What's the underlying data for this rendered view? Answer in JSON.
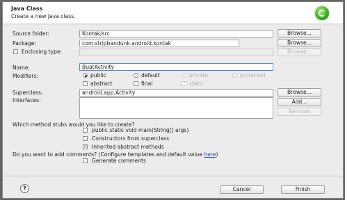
{
  "dialog": {
    "title": "Java Class",
    "message": "Create a new Java class."
  },
  "form": {
    "source_folder": {
      "label": "Source folder:",
      "value": "Kontak/src",
      "browse": "Browse..."
    },
    "package": {
      "label": "Package:",
      "value": "com.stripbandunk.android.kontak",
      "browse": "Browse..."
    },
    "enclosing_type": {
      "label": "Enclosing type:",
      "value": "",
      "browse": "Browse..."
    },
    "name": {
      "label": "Name:",
      "value": "BuatActivity"
    },
    "modifiers": {
      "label": "Modifiers:",
      "public": "public",
      "default": "default",
      "private": "private",
      "protected": "protected",
      "abstract": "abstract",
      "final": "final",
      "static": "static",
      "selected": "public"
    },
    "superclass": {
      "label": "Superclass:",
      "value": "android.app.Activity",
      "browse": "Browse..."
    },
    "interfaces": {
      "label": "Interfaces:",
      "add": "Add...",
      "remove": "Remove"
    },
    "stubs": {
      "question": "Which method stubs would you like to create?",
      "main": "public static void main(String[] args)",
      "constructors": "Constructors from superclass",
      "inherited": "Inherited abstract methods"
    },
    "comments": {
      "question": "Do you want to add comments? (Configure templates and default value ",
      "link": "here",
      "question_end": ")",
      "generate": "Generate comments"
    }
  },
  "footer": {
    "help": "?",
    "cancel": "Cancel",
    "finish": "Finish"
  }
}
